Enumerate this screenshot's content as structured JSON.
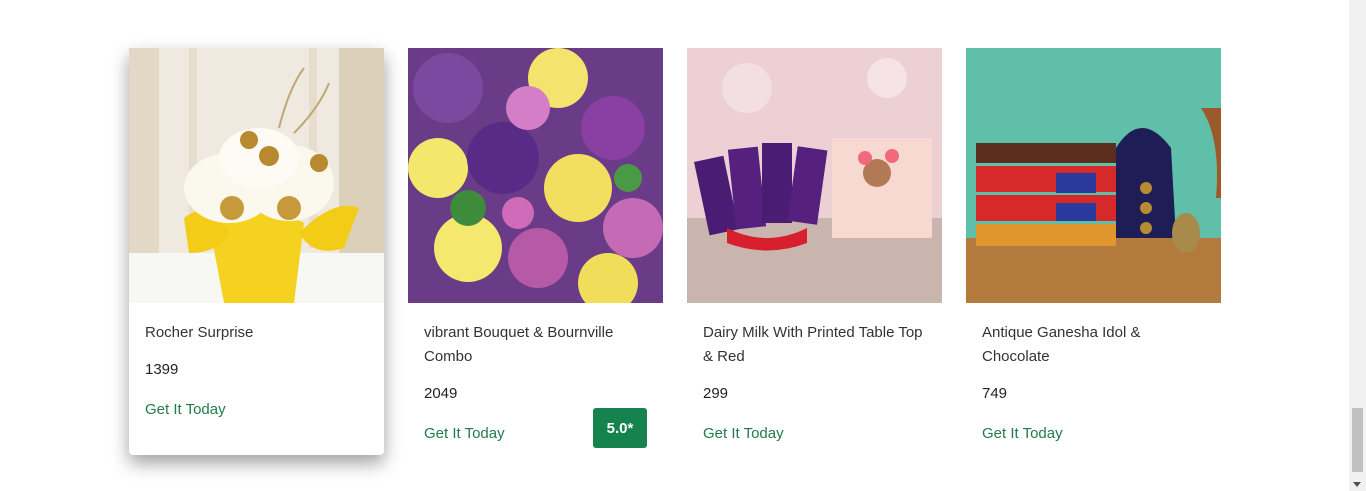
{
  "products": [
    {
      "title": "Rocher Surprise",
      "price": "1399",
      "cta": "Get It Today"
    },
    {
      "title": "vibrant Bouquet & Bournville Combo",
      "price": "2049",
      "cta": "Get It Today",
      "rating": "5.0*"
    },
    {
      "title": "Dairy Milk With Printed Table Top & Red",
      "price": "299",
      "cta": "Get It Today"
    },
    {
      "title": "Antique Ganesha Idol & Chocolate",
      "price": "749",
      "cta": "Get It Today"
    }
  ],
  "colors": {
    "accent_green": "#237a4b",
    "rating_bg": "#16834f"
  }
}
